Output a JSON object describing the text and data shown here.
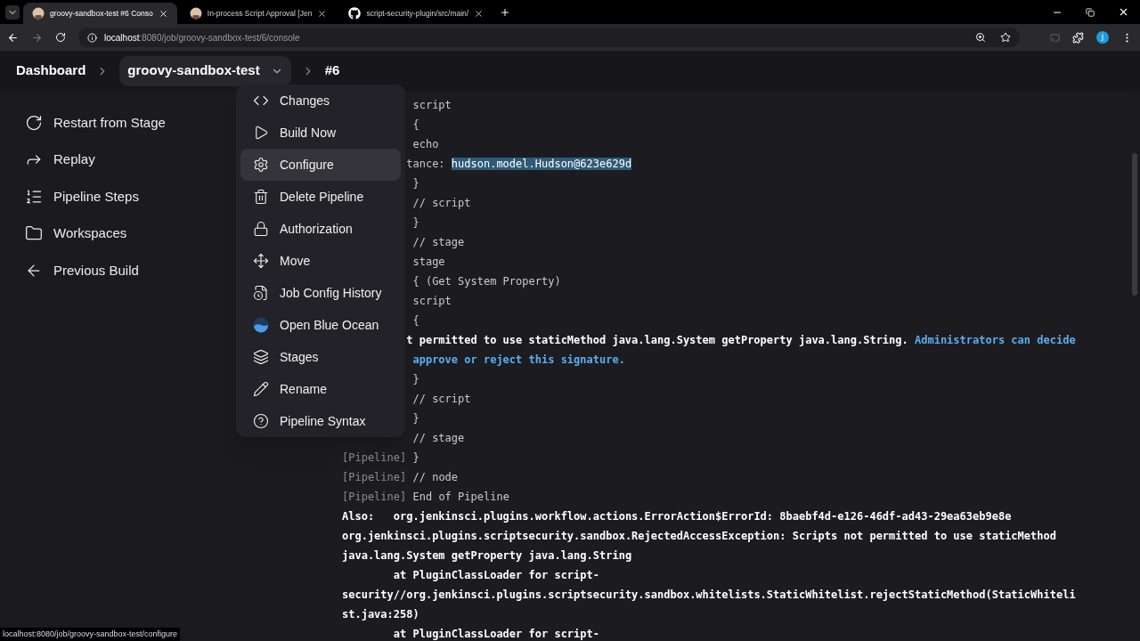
{
  "browser": {
    "tabs": [
      {
        "title": "groovy-sandbox-test #6 Conso",
        "selected": true
      },
      {
        "title": "In-process Script Approval [Jen",
        "selected": false
      },
      {
        "title": "script-security-plugin/src/main/",
        "selected": false
      }
    ],
    "url_host": "localhost",
    "url_rest": ":8080/job/groovy-sandbox-test/6/console",
    "avatar": "j"
  },
  "breadcrumb": {
    "root": "Dashboard",
    "job": "groovy-sandbox-test",
    "build": "#6"
  },
  "sidebar": {
    "items": [
      {
        "label": "Restart from Stage"
      },
      {
        "label": "Replay"
      },
      {
        "label": "Pipeline Steps"
      },
      {
        "label": "Workspaces"
      },
      {
        "label": "Previous Build"
      }
    ]
  },
  "menu": {
    "items": [
      {
        "label": "Changes",
        "selected": false
      },
      {
        "label": "Build Now",
        "selected": false
      },
      {
        "label": "Configure",
        "selected": true
      },
      {
        "label": "Delete Pipeline",
        "selected": false
      },
      {
        "label": "Authorization",
        "selected": false
      },
      {
        "label": "Move",
        "selected": false
      },
      {
        "label": "Job Config History",
        "selected": false
      },
      {
        "label": "Open Blue Ocean",
        "selected": false
      },
      {
        "label": "Stages",
        "selected": false
      },
      {
        "label": "Rename",
        "selected": false
      },
      {
        "label": "Pipeline Syntax",
        "selected": false
      }
    ]
  },
  "console": {
    "lines": [
      {
        "kind": "covered",
        "parts": [
          {
            "text": "script"
          }
        ]
      },
      {
        "kind": "covered",
        "parts": [
          {
            "text": "{"
          }
        ]
      },
      {
        "kind": "covered",
        "parts": [
          {
            "text": "echo"
          }
        ]
      },
      {
        "kind": "covered_cut",
        "parts": [
          {
            "text": "tance: "
          },
          {
            "text": "hudson.model.Hudson@623e629d",
            "selected": true
          }
        ]
      },
      {
        "kind": "covered",
        "parts": [
          {
            "text": "}"
          }
        ]
      },
      {
        "kind": "covered",
        "parts": [
          {
            "text": "// script"
          }
        ]
      },
      {
        "kind": "covered",
        "parts": [
          {
            "text": "}"
          }
        ]
      },
      {
        "kind": "covered",
        "parts": [
          {
            "text": "// stage"
          }
        ]
      },
      {
        "kind": "covered",
        "parts": [
          {
            "text": "stage"
          }
        ]
      },
      {
        "kind": "covered",
        "parts": [
          {
            "text": "{ (Get System Property)"
          }
        ]
      },
      {
        "kind": "covered",
        "parts": [
          {
            "text": "script"
          }
        ]
      },
      {
        "kind": "covered",
        "parts": [
          {
            "text": "{"
          }
        ]
      },
      {
        "kind": "error_cut",
        "parts": [
          {
            "text": "t permitted to use staticMethod java.lang.System getProperty java.lang.String. "
          },
          {
            "text": "Administrators can decide",
            "link": true
          }
        ]
      },
      {
        "kind": "covered",
        "parts": [
          {
            "text": "approve or reject this signature.",
            "link": true
          }
        ]
      },
      {
        "kind": "covered",
        "parts": [
          {
            "text": "}"
          }
        ]
      },
      {
        "kind": "covered",
        "parts": [
          {
            "text": "// script"
          }
        ]
      },
      {
        "kind": "covered",
        "parts": [
          {
            "text": "}"
          }
        ]
      },
      {
        "kind": "covered",
        "parts": [
          {
            "text": "// stage"
          }
        ]
      },
      {
        "kind": "pipeline",
        "prefix": "[Pipeline]",
        "parts": [
          {
            "text": "}"
          }
        ]
      },
      {
        "kind": "pipeline",
        "prefix": "[Pipeline]",
        "parts": [
          {
            "text": "// node"
          }
        ]
      },
      {
        "kind": "pipeline",
        "prefix": "[Pipeline]",
        "parts": [
          {
            "text": "End of Pipeline"
          }
        ]
      },
      {
        "kind": "plain",
        "parts": [
          {
            "text": "Also:   org.jenkinsci.plugins.workflow.actions.ErrorAction$ErrorId: 8baebf4d-e126-46df-ad43-29ea63eb9e8e"
          }
        ]
      },
      {
        "kind": "plain",
        "parts": [
          {
            "text": "org.jenkinsci.plugins.scriptsecurity.sandbox.RejectedAccessException: Scripts not permitted to use staticMethod"
          }
        ]
      },
      {
        "kind": "plain",
        "parts": [
          {
            "text": "java.lang.System getProperty java.lang.String"
          }
        ]
      },
      {
        "kind": "plain",
        "parts": [
          {
            "text": "        at PluginClassLoader for script-"
          }
        ]
      },
      {
        "kind": "plain",
        "parts": [
          {
            "text": "security//org.jenkinsci.plugins.scriptsecurity.sandbox.whitelists.StaticWhitelist.rejectStaticMethod(StaticWhiteli"
          }
        ]
      },
      {
        "kind": "plain",
        "parts": [
          {
            "text": "st.java:258)"
          }
        ]
      },
      {
        "kind": "plain",
        "parts": [
          {
            "text": "        at PluginClassLoader for script-"
          }
        ]
      }
    ]
  },
  "status_bar": "localhost:8080/job/groovy-sandbox-test/configure"
}
